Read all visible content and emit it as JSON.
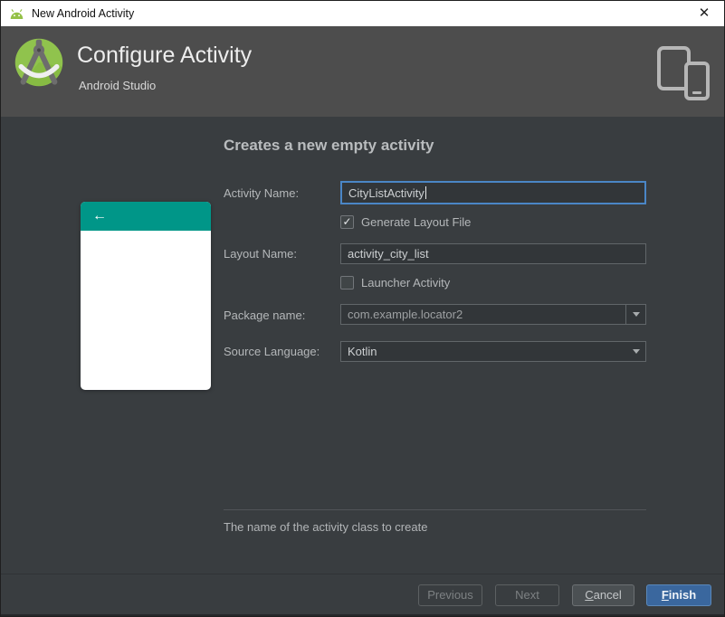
{
  "window": {
    "title": "New Android Activity",
    "close_glyph": "✕"
  },
  "header": {
    "title": "Configure Activity",
    "subtitle": "Android Studio"
  },
  "main": {
    "heading": "Creates a new empty activity",
    "preview": {
      "back_glyph": "←"
    },
    "form": {
      "activity_name_label": "Activity Name:",
      "activity_name_value": "CityListActivity",
      "generate_layout_label": "Generate Layout File",
      "generate_layout_check": "✓",
      "layout_name_label": "Layout Name:",
      "layout_name_value": "activity_city_list",
      "launcher_label": "Launcher Activity",
      "launcher_check": "",
      "package_label": "Package name:",
      "package_value": "com.example.locator2",
      "language_label": "Source Language:",
      "language_value": "Kotlin"
    },
    "hint": "The name of the activity class to create"
  },
  "footer": {
    "previous_label": "Previous",
    "next_label": "Next",
    "cancel_mnemonic": "C",
    "cancel_rest": "ancel",
    "finish_mnemonic": "F",
    "finish_rest": "inish"
  },
  "colors": {
    "accent_teal": "#009688",
    "android_green": "#90C34D",
    "focus_blue": "#4A86C6",
    "finish_blue": "#3A679E",
    "header_gray": "#4D4D4D",
    "panel_dark": "#393D40"
  }
}
